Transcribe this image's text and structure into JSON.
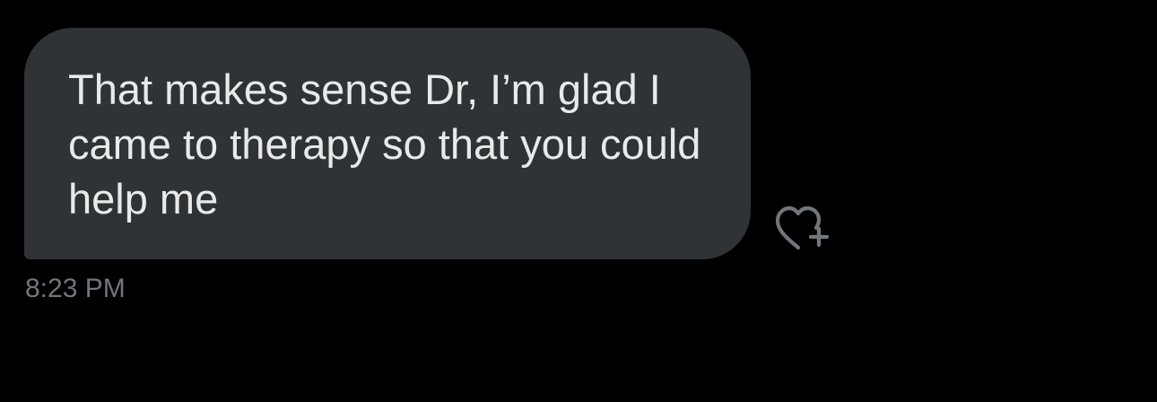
{
  "message": {
    "text": "That makes sense Dr, I’m glad I came to therapy so that you could help me",
    "timestamp": "8:23 PM"
  },
  "reaction": {
    "icon": "heart-plus-icon"
  },
  "colors": {
    "background": "#000000",
    "bubble": "#2f3336",
    "text": "#e7e9ea",
    "muted": "#71767b"
  }
}
